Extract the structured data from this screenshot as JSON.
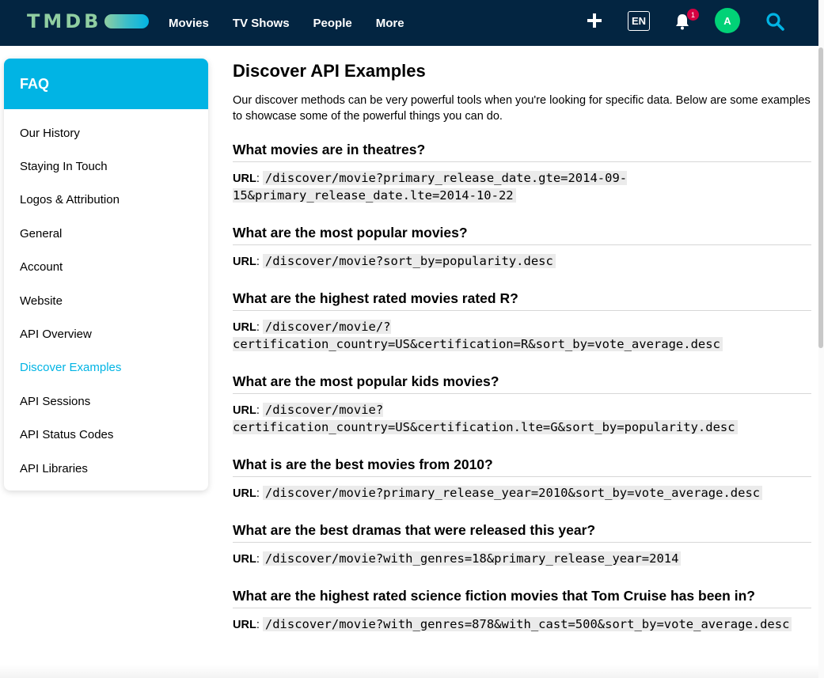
{
  "header": {
    "logo_text": "TMDB",
    "nav": [
      "Movies",
      "TV Shows",
      "People",
      "More"
    ],
    "lang": "EN",
    "notifications": "1",
    "avatar_initial": "A"
  },
  "colors": {
    "header_bg": "#032541",
    "accent": "#01b4e4",
    "avatar": "#01d277",
    "badge": "#d40242"
  },
  "sidebar": {
    "title": "FAQ",
    "items": [
      "Our History",
      "Staying In Touch",
      "Logos & Attribution",
      "General",
      "Account",
      "Website",
      "API Overview",
      "Discover Examples",
      "API Sessions",
      "API Status Codes",
      "API Libraries"
    ],
    "active": "Discover Examples"
  },
  "main": {
    "title": "Discover API Examples",
    "intro": "Our discover methods can be very powerful tools when you're looking for specific data. Below are some examples to showcase some of the powerful things you can do.",
    "url_label": "URL",
    "examples": [
      {
        "question": "What movies are in theatres?",
        "url_line1": "/discover/movie?primary_release_date.gte=2014-09-",
        "url_line2": "15&primary_release_date.lte=2014-10-22"
      },
      {
        "question": "What are the most popular movies?",
        "url_line1": "/discover/movie?sort_by=popularity.desc",
        "url_line2": ""
      },
      {
        "question": "What are the highest rated movies rated R?",
        "url_line1": "/discover/movie/?",
        "url_line2": "certification_country=US&certification=R&sort_by=vote_average.desc"
      },
      {
        "question": "What are the most popular kids movies?",
        "url_line1": "/discover/movie?",
        "url_line2": "certification_country=US&certification.lte=G&sort_by=popularity.desc"
      },
      {
        "question": "What is are the best movies from 2010?",
        "url_line1": "/discover/movie?primary_release_year=2010&sort_by=vote_average.desc",
        "url_line2": ""
      },
      {
        "question": "What are the best dramas that were released this year?",
        "url_line1": "/discover/movie?with_genres=18&primary_release_year=2014",
        "url_line2": ""
      },
      {
        "question": "What are the highest rated science fiction movies that Tom Cruise has been in?",
        "url_line1": "/discover/movie?with_genres=878&with_cast=500&sort_by=vote_average.desc",
        "url_line2": ""
      }
    ]
  }
}
